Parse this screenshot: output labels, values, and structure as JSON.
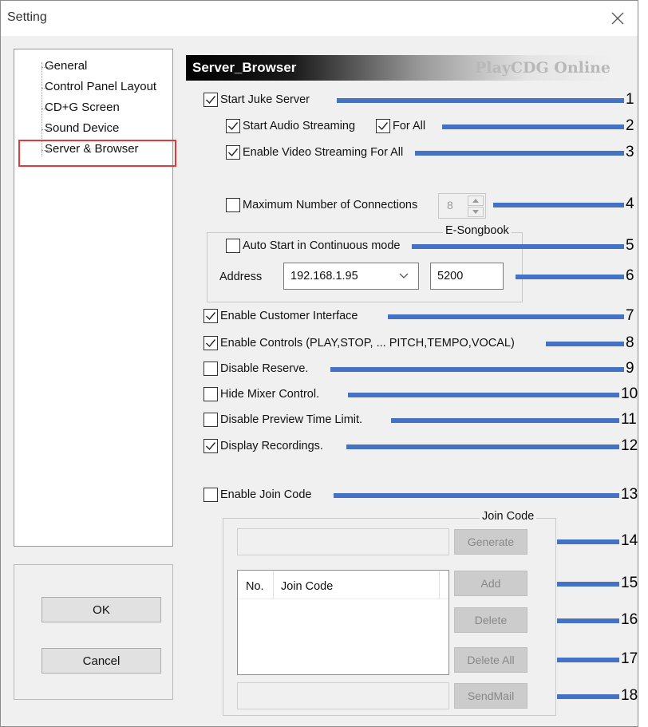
{
  "window": {
    "title": "Setting"
  },
  "tree": {
    "items": [
      {
        "label": "General"
      },
      {
        "label": "Control Panel Layout"
      },
      {
        "label": "CD+G Screen"
      },
      {
        "label": "Sound Device"
      },
      {
        "label": "Server & Browser"
      }
    ]
  },
  "buttons": {
    "ok": "OK",
    "cancel": "Cancel"
  },
  "header": {
    "title": "Server_Browser",
    "brand": "PlayCDG Online"
  },
  "options": {
    "start_juke_server": {
      "label": "Start Juke Server",
      "checked": true
    },
    "start_audio_streaming": {
      "label": "Start Audio Streaming",
      "checked": true
    },
    "for_all": {
      "label": "For All",
      "checked": true
    },
    "enable_video_streaming": {
      "label": "Enable Video Streaming For All",
      "checked": true
    },
    "max_connections": {
      "label": "Maximum Number of Connections",
      "checked": false,
      "value": "8"
    },
    "enable_customer_interface": {
      "label": "Enable Customer Interface",
      "checked": true
    },
    "enable_controls": {
      "label": "Enable Controls (PLAY,STOP, ... PITCH,TEMPO,VOCAL)",
      "checked": true
    },
    "disable_reserve": {
      "label": "Disable Reserve.",
      "checked": false
    },
    "hide_mixer_control": {
      "label": "Hide Mixer Control.",
      "checked": false
    },
    "disable_preview_time_limit": {
      "label": "Disable Preview Time Limit.",
      "checked": false
    },
    "display_recordings": {
      "label": "Display Recordings.",
      "checked": true
    },
    "enable_join_code": {
      "label": "Enable Join Code",
      "checked": false
    }
  },
  "esongbook": {
    "legend": "E-Songbook",
    "auto_start": {
      "label": "Auto Start in Continuous mode",
      "checked": false
    },
    "address_label": "Address",
    "address_value": "192.168.1.95",
    "port_value": "5200"
  },
  "joincode": {
    "legend": "Join Code",
    "generate": "Generate",
    "add": "Add",
    "delete": "Delete",
    "delete_all": "Delete All",
    "sendmail": "SendMail",
    "columns": [
      "No.",
      "Join Code"
    ]
  },
  "callouts": [
    "1",
    "2",
    "3",
    "4",
    "5",
    "6",
    "7",
    "8",
    "9",
    "10",
    "11",
    "12",
    "13",
    "14",
    "15",
    "16",
    "17",
    "18"
  ],
  "colors": {
    "callout_line": "#4472c4",
    "highlight": "#e03a3a"
  }
}
